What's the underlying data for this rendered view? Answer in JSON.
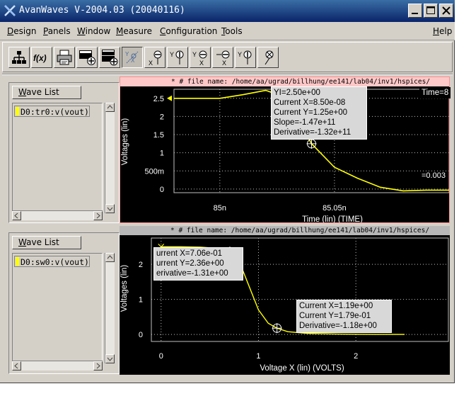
{
  "window": {
    "title": "AvanWaves V-2004.03 (20040116)",
    "controls": [
      "minimize-icon",
      "maximize-icon",
      "close-icon"
    ]
  },
  "menubar": {
    "items": [
      {
        "label": "Design",
        "mnemonic": "D"
      },
      {
        "label": "Panels",
        "mnemonic": "P"
      },
      {
        "label": "Window",
        "mnemonic": "W"
      },
      {
        "label": "Measure",
        "mnemonic": "M"
      },
      {
        "label": "Configuration",
        "mnemonic": "C"
      },
      {
        "label": "Tools",
        "mnemonic": "T"
      }
    ],
    "help": {
      "label": "Help",
      "mnemonic": "H"
    }
  },
  "toolbar": {
    "tools": [
      {
        "icon": "hierarchy-icon"
      },
      {
        "icon": "function-fx-icon",
        "label": "f(x)"
      },
      {
        "icon": "print-icon"
      },
      {
        "icon": "add-panel-icon"
      },
      {
        "icon": "add-panels-icon"
      },
      {
        "icon": "measure-xy-icon"
      },
      {
        "icon": "measure-x-icon"
      },
      {
        "icon": "measure-y-icon"
      },
      {
        "icon": "delta-y-icon"
      },
      {
        "icon": "delta-x-icon"
      },
      {
        "icon": "slope-icon"
      },
      {
        "icon": "point-marker-icon"
      }
    ]
  },
  "panels": [
    {
      "wave_list_label": "Wave List",
      "wave_list_mnemonic": "W",
      "wave": "D0:tr0:v(vout)",
      "file_header": "* # file name: /home/aa/ugrad/billhung/ee141/lab04/inv1/hspices/",
      "annotations": {
        "box": [
          "YI=2.50e+00",
          "Current X=8.50e-08",
          "Current Y=1.25e+00",
          "Slope=-1.47e+11",
          "Derivative=-1.32e+11"
        ],
        "time_label": "Time=8",
        "right_value": "=0.003"
      },
      "chart_data": {
        "type": "line",
        "xlabel": "Time (lin) (TIME)",
        "ylabel": "Voltages (lin)",
        "x_tick_labels": [
          "85n",
          "85.05n"
        ],
        "x_ticks_ns": [
          85.0,
          85.05
        ],
        "y_tick_labels": [
          "2.5",
          "2",
          "1.5",
          "1",
          "500m",
          "0"
        ],
        "y_ticks": [
          2.5,
          2.0,
          1.5,
          1.0,
          0.5,
          0.0
        ],
        "xlim_ns": [
          84.98,
          85.1
        ],
        "ylim": [
          -0.1,
          2.75
        ],
        "grid": true,
        "series": [
          {
            "color": "#ffff00",
            "x_ns": [
              84.98,
              85.0,
              85.01,
              85.02,
              85.03,
              85.035,
              85.04,
              85.05,
              85.06,
              85.07,
              85.08,
              85.09,
              85.1
            ],
            "y": [
              2.5,
              2.5,
              2.6,
              2.72,
              2.5,
              1.8,
              1.25,
              0.6,
              0.3,
              0.05,
              -0.05,
              -0.03,
              -0.03
            ]
          }
        ],
        "markers": [
          {
            "x_ns": 85.03,
            "y": 2.5
          },
          {
            "x_ns": 85.04,
            "y": 1.25
          }
        ]
      }
    },
    {
      "wave_list_label": "Wave List",
      "wave_list_mnemonic": "W",
      "wave": "D0:sw0:v(vout)",
      "file_header": "* # file name: /home/aa/ugrad/billhung/ee141/lab04/inv1/hspices/",
      "annotations": {
        "box1": [
          "urrent X=7.06e-01",
          "urrent Y=2.36e+00",
          "erivative=-1.31e+00"
        ],
        "box2": [
          "Current X=1.19e+00",
          "Current Y=1.79e-01",
          "Derivative=-1.18e+00"
        ]
      },
      "chart_data": {
        "type": "line",
        "xlabel": "Voltage X (lin) (VOLTS)",
        "ylabel": "Voltages (lin)",
        "x_ticks": [
          0,
          1,
          2
        ],
        "y_ticks": [
          0,
          1,
          2
        ],
        "xlim": [
          -0.1,
          2.95
        ],
        "ylim": [
          -0.2,
          2.75
        ],
        "grid": true,
        "series": [
          {
            "color": "#ffff00",
            "x": [
              0.0,
              0.2,
              0.4,
              0.6,
              0.706,
              0.8,
              0.9,
              1.0,
              1.1,
              1.19,
              1.3,
              1.5,
              1.8,
              2.2,
              2.5
            ],
            "y": [
              2.5,
              2.5,
              2.49,
              2.45,
              2.36,
              2.1,
              1.4,
              0.7,
              0.32,
              0.179,
              0.08,
              0.03,
              0.01,
              0.0,
              0.0
            ]
          }
        ],
        "markers": [
          {
            "x": 0.706,
            "y": 2.36
          },
          {
            "x": 1.19,
            "y": 0.179
          }
        ]
      }
    }
  ]
}
